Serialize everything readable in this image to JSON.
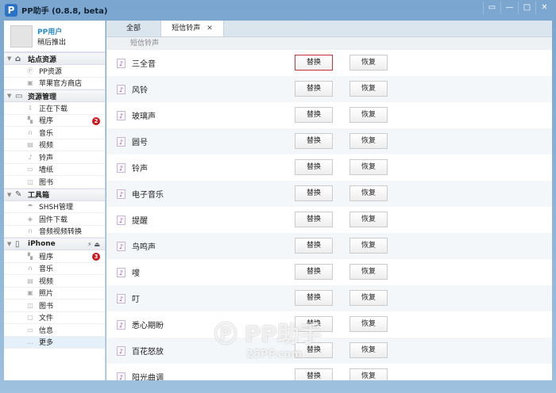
{
  "window": {
    "title": "PP助手 (0.8.8, beta)",
    "logo": "P"
  },
  "user": {
    "name": "PP用户",
    "action": "稍后推出"
  },
  "sidebar": {
    "sections": [
      {
        "label": "站点资源",
        "icon": "home-icon",
        "items": [
          {
            "label": "PP资源",
            "icon": "pp-icon"
          },
          {
            "label": "苹果官方商店",
            "icon": "store-icon"
          }
        ]
      },
      {
        "label": "资源管理",
        "icon": "monitor-icon",
        "items": [
          {
            "label": "正在下载",
            "icon": "download-icon"
          },
          {
            "label": "程序",
            "icon": "apps-icon",
            "badge": "2"
          },
          {
            "label": "音乐",
            "icon": "headphones-icon"
          },
          {
            "label": "视频",
            "icon": "film-icon"
          },
          {
            "label": "铃声",
            "icon": "note-icon"
          },
          {
            "label": "墙纸",
            "icon": "image-icon"
          },
          {
            "label": "图书",
            "icon": "book-icon"
          }
        ]
      },
      {
        "label": "工具箱",
        "icon": "toolbox-icon",
        "items": [
          {
            "label": "SHSH管理",
            "icon": "shsh-icon"
          },
          {
            "label": "固件下载",
            "icon": "firmware-icon"
          },
          {
            "label": "音频视频转换",
            "icon": "convert-icon"
          }
        ]
      },
      {
        "label": "iPhone",
        "icon": "phone-icon",
        "items": [
          {
            "label": "程序",
            "icon": "apps-icon",
            "badge": "3"
          },
          {
            "label": "音乐",
            "icon": "headphones-icon"
          },
          {
            "label": "视频",
            "icon": "film-icon"
          },
          {
            "label": "照片",
            "icon": "photo-icon"
          },
          {
            "label": "图书",
            "icon": "book-icon"
          },
          {
            "label": "文件",
            "icon": "file-icon"
          },
          {
            "label": "信息",
            "icon": "message-icon"
          },
          {
            "label": "更多",
            "icon": "more-icon"
          }
        ]
      }
    ]
  },
  "tabs": [
    {
      "label": "全部"
    },
    {
      "label": "短信铃声"
    }
  ],
  "subheader": "短信铃声",
  "buttons": {
    "replace": "替换",
    "restore": "恢复"
  },
  "ringtones": [
    "三全音",
    "风铃",
    "玻璃声",
    "圆号",
    "铃声",
    "电子音乐",
    "提醒",
    "鸟鸣声",
    "嗖",
    "叮",
    "悉心期盼",
    "百花怒放",
    "阳光曲调"
  ],
  "watermark": {
    "text": "PP助手",
    "url": "25PP.com"
  }
}
